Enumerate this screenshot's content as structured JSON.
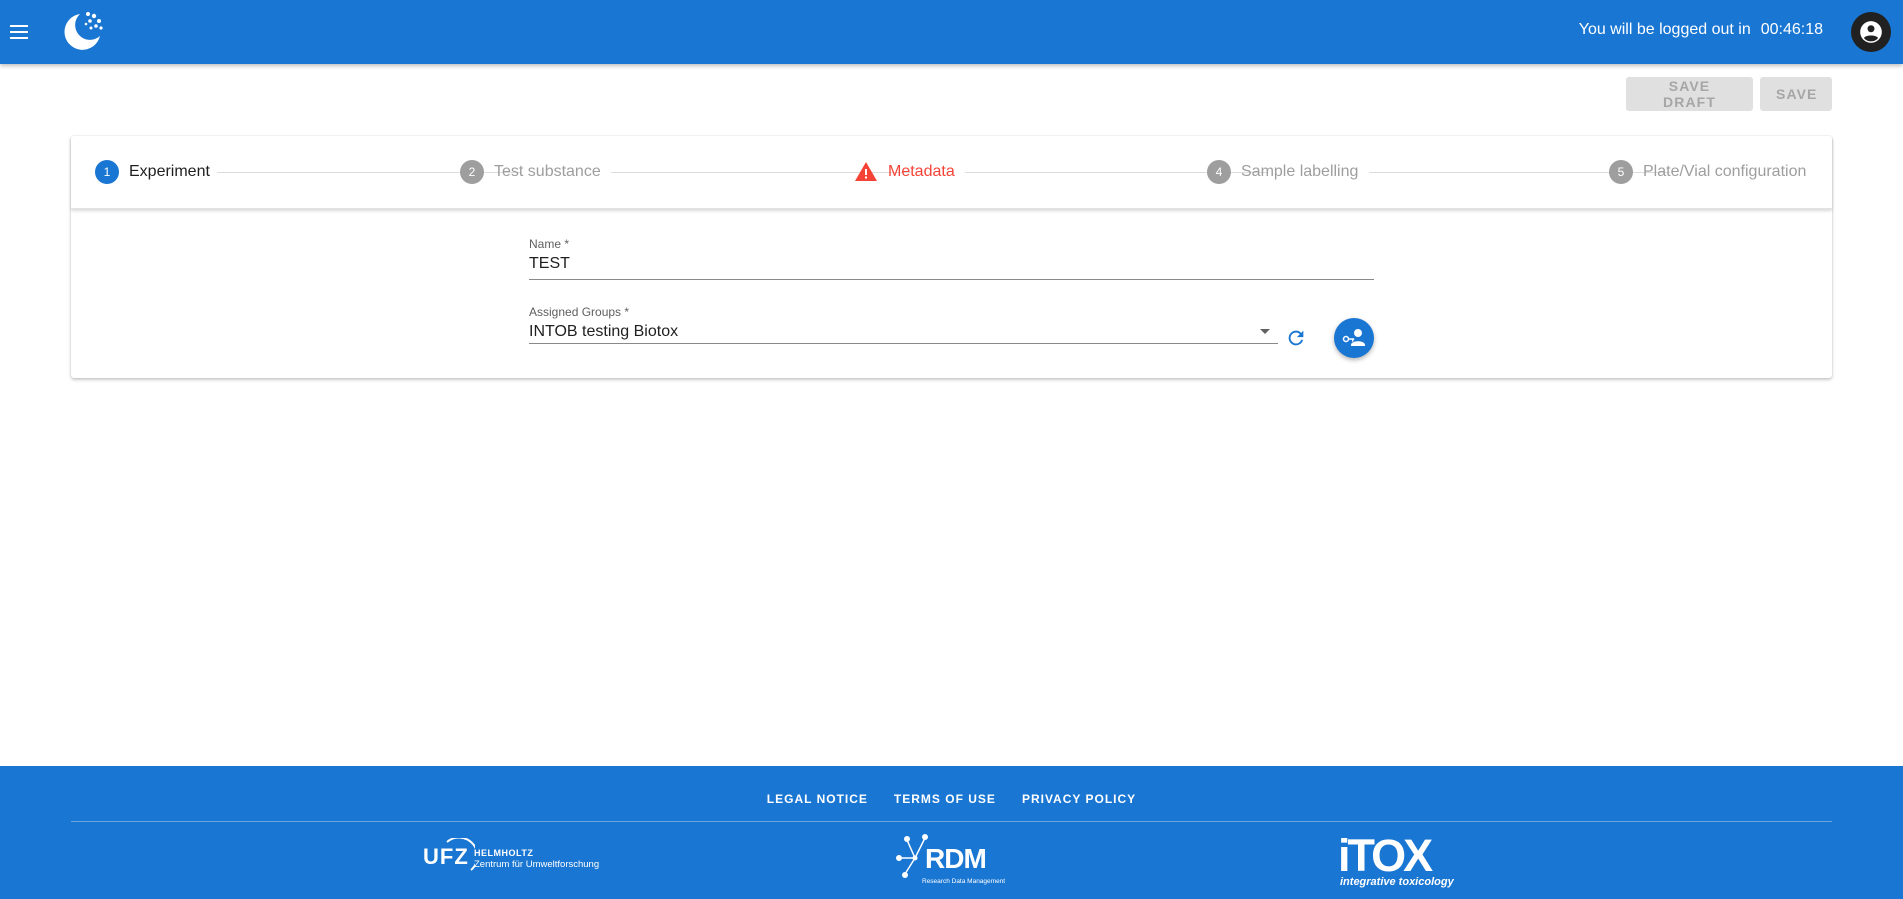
{
  "appbar": {
    "session_prefix": "You will be logged out in",
    "session_timer": "00:46:18",
    "menu_icon": "menu-icon",
    "account_icon": "account-circle-icon"
  },
  "actions": {
    "save_draft_label": "SAVE DRAFT",
    "save_label": "SAVE"
  },
  "stepper": {
    "steps": [
      {
        "number": "1",
        "label": "Experiment",
        "state": "active"
      },
      {
        "number": "2",
        "label": "Test substance",
        "state": "inactive"
      },
      {
        "number": "",
        "label": "Metadata",
        "state": "error"
      },
      {
        "number": "4",
        "label": "Sample labelling",
        "state": "inactive"
      },
      {
        "number": "5",
        "label": "Plate/Vial configuration",
        "state": "inactive"
      }
    ]
  },
  "form": {
    "name_label": "Name *",
    "name_value": "TEST",
    "groups_label": "Assigned Groups *",
    "groups_value": "INTOB testing Biotox"
  },
  "footer": {
    "links": [
      "LEGAL NOTICE",
      "TERMS OF USE",
      "PRIVACY POLICY"
    ],
    "ufz_mark": "UFZ",
    "ufz_line1": "HELMHOLTZ",
    "ufz_line2": "Zentrum für Umweltforschung",
    "rdm_mark": "RDM",
    "rdm_sub": "Research Data Management",
    "itox_mark": "iTOX",
    "itox_sub": "integrative toxicology"
  },
  "colors": {
    "primary": "#1976d2",
    "error": "#f44336",
    "disabled_bg": "#e0e0e0",
    "disabled_text": "#a6a6a6"
  }
}
